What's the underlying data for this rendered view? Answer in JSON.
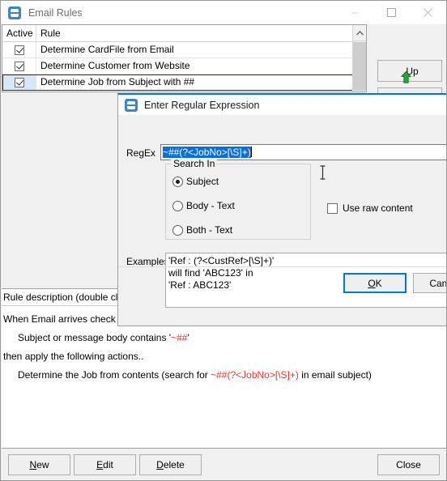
{
  "window": {
    "title": "Email Rules",
    "icon": "email-rules-icon",
    "controls": {
      "minimize": "minimize-icon",
      "maximize": "maximize-icon",
      "close": "close-icon"
    }
  },
  "grid": {
    "columns": [
      "Active",
      "Rule"
    ],
    "rows": [
      {
        "active": true,
        "rule": "Determine CardFile from Email",
        "selected": false
      },
      {
        "active": true,
        "rule": "Determine Customer from Website",
        "selected": false
      },
      {
        "active": true,
        "rule": "Determine Job from Subject with ##",
        "selected": true
      }
    ]
  },
  "side_buttons": {
    "up": "Up",
    "down": ""
  },
  "description": {
    "header": "Rule description (double click t",
    "line1": "When Email arrives check if..",
    "line2_prefix": "Subject or message body contains '",
    "line2_regex": "~##",
    "line2_suffix": "'",
    "line3": "then apply the following actions..",
    "line4_prefix": "Determine the Job from contents (search for ",
    "line4_regex": "~##(?<JobNo>[\\S]+)",
    "line4_suffix": " in email subject)"
  },
  "footer_buttons": {
    "new": {
      "pre": "N",
      "accel": "N",
      "post": "ew",
      "label": "New"
    },
    "edit": {
      "pre": "",
      "accel": "E",
      "post": "dit",
      "label": "Edit"
    },
    "delete": {
      "pre": "",
      "accel": "D",
      "post": "elete",
      "label": "Delete"
    },
    "close": {
      "label": "Close"
    }
  },
  "dialog": {
    "title": "Enter Regular Expression",
    "icon": "email-rules-icon",
    "regex_label": "RegEx",
    "regex_value": "~##(?<JobNo>[\\S]+)",
    "search_in": {
      "legend": "Search In",
      "options": [
        {
          "label": "Subject",
          "selected": true
        },
        {
          "label": "Body - Text",
          "selected": false
        },
        {
          "label": "Both - Text",
          "selected": false
        }
      ]
    },
    "use_raw_content": {
      "label": "Use raw content",
      "checked": false
    },
    "examples_label": "Examples",
    "examples_value": "'Ref : (?<CustRef>[\\S]+)'\nwill find 'ABC123' in\n'Ref : ABC123'",
    "buttons": {
      "ok": {
        "accel": "O",
        "post": "K",
        "label": "OK"
      },
      "cancel": {
        "label": "Cancel"
      }
    }
  },
  "colors": {
    "accent": "#0078d7",
    "selection": "#0b6fd8",
    "regex_red": "#e8352c",
    "row_selected": "#d6e7f8",
    "arrow_green": "#2eaa36"
  }
}
